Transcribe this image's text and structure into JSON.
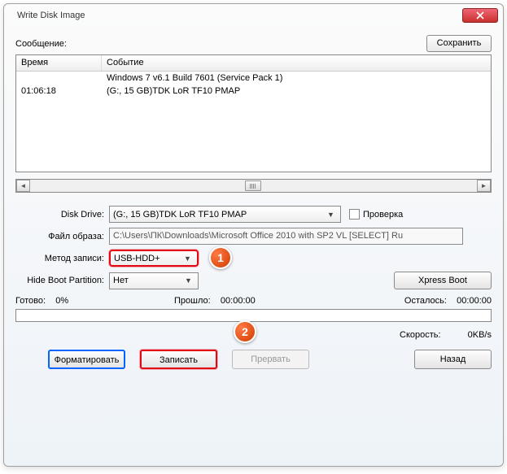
{
  "window": {
    "title": "Write Disk Image"
  },
  "msg": {
    "label": "Сообщение:",
    "save": "Сохранить"
  },
  "log": {
    "headers": {
      "time": "Время",
      "event": "Событие"
    },
    "rows": [
      {
        "time": "",
        "event": "Windows 7 v6.1 Build 7601 (Service Pack 1)"
      },
      {
        "time": "01:06:18",
        "event": "(G:, 15 GB)TDK LoR TF10          PMAP"
      }
    ]
  },
  "form": {
    "disk_drive_label": "Disk Drive:",
    "disk_drive_value": "(G:, 15 GB)TDK LoR TF10          PMAP",
    "check_label": "Проверка",
    "image_file_label": "Файл образа:",
    "image_file_value": "C:\\Users\\ПК\\Downloads\\Microsoft Office 2010 with SP2 VL [SELECT] Ru",
    "write_method_label": "Метод записи:",
    "write_method_value": "USB-HDD+",
    "hide_boot_label": "Hide Boot Partition:",
    "hide_boot_value": "Нет",
    "xpress": "Xpress Boot"
  },
  "progress": {
    "ready_label": "Готово:",
    "ready_value": "0%",
    "elapsed_label": "Прошло:",
    "elapsed_value": "00:00:00",
    "remain_label": "Осталось:",
    "remain_value": "00:00:00"
  },
  "info": {
    "speed_label": "Скорость:",
    "speed_value": "0KB/s"
  },
  "buttons": {
    "format": "Форматировать",
    "write": "Записать",
    "abort": "Прервать",
    "back": "Назад"
  },
  "badges": {
    "one": "1",
    "two": "2"
  }
}
